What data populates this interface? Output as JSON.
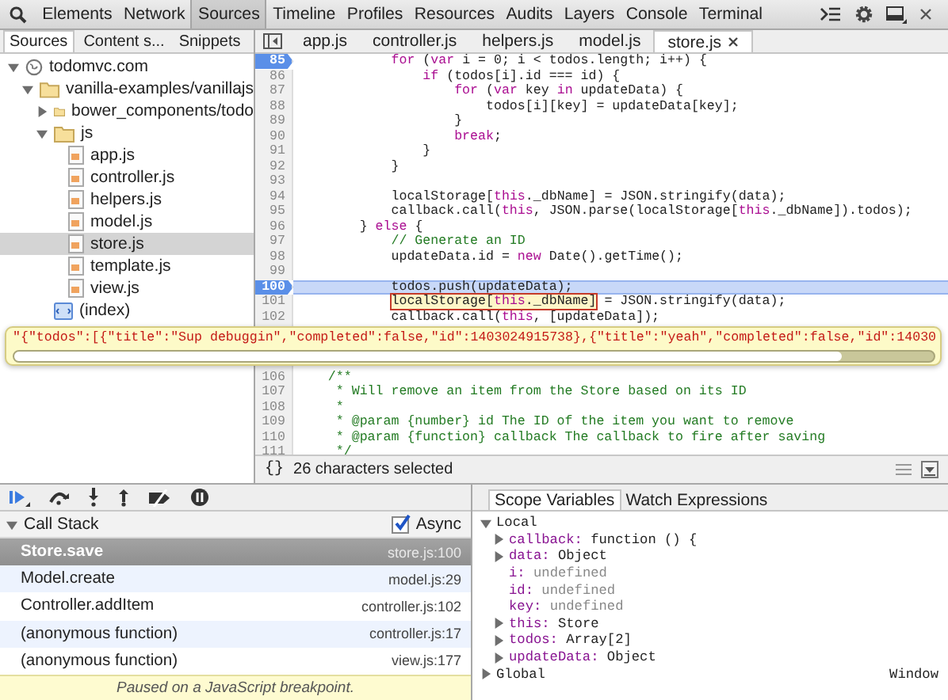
{
  "toolbar": {
    "tabs": [
      {
        "label": "Elements",
        "selected": false
      },
      {
        "label": "Network",
        "selected": false
      },
      {
        "label": "Sources",
        "selected": true
      },
      {
        "label": "Timeline",
        "selected": false
      },
      {
        "label": "Profiles",
        "selected": false
      },
      {
        "label": "Resources",
        "selected": false
      },
      {
        "label": "Audits",
        "selected": false
      },
      {
        "label": "Layers",
        "selected": false
      },
      {
        "label": "Console",
        "selected": false
      },
      {
        "label": "Terminal",
        "selected": false
      }
    ]
  },
  "navigator": {
    "tabs": [
      {
        "label": "Sources",
        "selected": true
      },
      {
        "label": "Content s...",
        "selected": false
      },
      {
        "label": "Snippets",
        "selected": false
      }
    ],
    "tree": [
      {
        "label": "todomvc.com",
        "kind": "domain",
        "expanded": true,
        "children": [
          {
            "label": "vanilla-examples/vanillajs",
            "kind": "folder",
            "expanded": true,
            "children": [
              {
                "label": "bower_components/todo",
                "kind": "folder",
                "expanded": false
              },
              {
                "label": "js",
                "kind": "folder",
                "expanded": true,
                "children": [
                  {
                    "label": "app.js",
                    "kind": "file",
                    "selected": false
                  },
                  {
                    "label": "controller.js",
                    "kind": "file",
                    "selected": false
                  },
                  {
                    "label": "helpers.js",
                    "kind": "file",
                    "selected": false
                  },
                  {
                    "label": "model.js",
                    "kind": "file",
                    "selected": false
                  },
                  {
                    "label": "store.js",
                    "kind": "file",
                    "selected": true
                  },
                  {
                    "label": "template.js",
                    "kind": "file",
                    "selected": false
                  },
                  {
                    "label": "view.js",
                    "kind": "file",
                    "selected": false
                  }
                ]
              },
              {
                "label": "(index)",
                "kind": "document",
                "selected": false
              }
            ]
          }
        ]
      }
    ]
  },
  "editor": {
    "tabs": [
      {
        "label": "app.js",
        "selected": false,
        "closable": false
      },
      {
        "label": "controller.js",
        "selected": false,
        "closable": false
      },
      {
        "label": "helpers.js",
        "selected": false,
        "closable": false
      },
      {
        "label": "model.js",
        "selected": false,
        "closable": false
      },
      {
        "label": "store.js",
        "selected": true,
        "closable": true
      }
    ],
    "lines": [
      {
        "number": "85",
        "breakpoint": true,
        "current": false,
        "tokens": [
          {
            "kind": "keyword",
            "text": "            for"
          },
          {
            "kind": "plain",
            "text": " ("
          },
          {
            "kind": "keyword",
            "text": "var"
          },
          {
            "kind": "plain",
            "text": " i = 0; i < todos.length; i++) {"
          }
        ]
      },
      {
        "number": "86",
        "breakpoint": false,
        "current": false,
        "tokens": [
          {
            "kind": "keyword",
            "text": "                if"
          },
          {
            "kind": "plain",
            "text": " (todos[i].id === id) {"
          }
        ]
      },
      {
        "number": "87",
        "breakpoint": false,
        "current": false,
        "tokens": [
          {
            "kind": "keyword",
            "text": "                    for"
          },
          {
            "kind": "plain",
            "text": " ("
          },
          {
            "kind": "keyword",
            "text": "var"
          },
          {
            "kind": "plain",
            "text": " key "
          },
          {
            "kind": "keyword",
            "text": "in"
          },
          {
            "kind": "plain",
            "text": " updateData) {"
          }
        ]
      },
      {
        "number": "88",
        "breakpoint": false,
        "current": false,
        "tokens": [
          {
            "kind": "plain",
            "text": "                        todos[i][key] = updateData[key];"
          }
        ]
      },
      {
        "number": "89",
        "breakpoint": false,
        "current": false,
        "tokens": [
          {
            "kind": "plain",
            "text": "                    }"
          }
        ]
      },
      {
        "number": "90",
        "breakpoint": false,
        "current": false,
        "tokens": [
          {
            "kind": "keyword",
            "text": "                    break"
          },
          {
            "kind": "plain",
            "text": ";"
          }
        ]
      },
      {
        "number": "91",
        "breakpoint": false,
        "current": false,
        "tokens": [
          {
            "kind": "plain",
            "text": "                }"
          }
        ]
      },
      {
        "number": "92",
        "breakpoint": false,
        "current": false,
        "tokens": [
          {
            "kind": "plain",
            "text": "            }"
          }
        ]
      },
      {
        "number": "93",
        "breakpoint": false,
        "current": false
      },
      {
        "number": "94",
        "breakpoint": false,
        "current": false,
        "tokens": [
          {
            "kind": "plain",
            "text": "            localStorage["
          },
          {
            "kind": "keyword",
            "text": "this"
          },
          {
            "kind": "plain",
            "text": "._dbName] = JSON.stringify(data);"
          }
        ]
      },
      {
        "number": "95",
        "breakpoint": false,
        "current": false,
        "tokens": [
          {
            "kind": "plain",
            "text": "            callback.call("
          },
          {
            "kind": "keyword",
            "text": "this"
          },
          {
            "kind": "plain",
            "text": ", JSON.parse(localStorage["
          },
          {
            "kind": "keyword",
            "text": "this"
          },
          {
            "kind": "plain",
            "text": "._dbName]).todos);"
          }
        ]
      },
      {
        "number": "96",
        "breakpoint": false,
        "current": false,
        "tokens": [
          {
            "kind": "plain",
            "text": "        } "
          },
          {
            "kind": "keyword",
            "text": "else"
          },
          {
            "kind": "plain",
            "text": " {"
          }
        ]
      },
      {
        "number": "97",
        "breakpoint": false,
        "current": false,
        "tokens": [
          {
            "kind": "comment",
            "text": "            // Generate an ID"
          }
        ]
      },
      {
        "number": "98",
        "breakpoint": false,
        "current": false,
        "tokens": [
          {
            "kind": "plain",
            "text": "            updateData.id = "
          },
          {
            "kind": "keyword",
            "text": "new"
          },
          {
            "kind": "plain",
            "text": " Date().getTime();"
          }
        ]
      },
      {
        "number": "99",
        "breakpoint": false,
        "current": false
      },
      {
        "number": "100",
        "breakpoint": true,
        "current": true,
        "tokens": [
          {
            "kind": "plain",
            "text": "            todos.push(updateData);"
          }
        ]
      },
      {
        "number": "101",
        "breakpoint": false,
        "current": false,
        "tokens": [
          {
            "kind": "highlight",
            "parts": [
              {
                "kind": "plain",
                "text": "            localStorage["
              },
              {
                "kind": "keyword",
                "text": "this"
              },
              {
                "kind": "plain",
                "text": "._dbName]"
              }
            ]
          },
          {
            "kind": "plain",
            "text": " = JSON.stringify(data);"
          }
        ]
      },
      {
        "number": "102",
        "breakpoint": false,
        "current": false,
        "tokens": [
          {
            "kind": "plain",
            "text": "            callback.call("
          },
          {
            "kind": "keyword",
            "text": "this"
          },
          {
            "kind": "plain",
            "text": ", [updateData]);"
          }
        ]
      },
      {
        "number": "106",
        "breakpoint": false,
        "current": false,
        "tokens": [
          {
            "kind": "comment",
            "text": "    /**"
          }
        ]
      },
      {
        "number": "107",
        "breakpoint": false,
        "current": false,
        "tokens": [
          {
            "kind": "comment",
            "text": "     * Will remove an item from the Store based on its ID"
          }
        ]
      },
      {
        "number": "108",
        "breakpoint": false,
        "current": false,
        "tokens": [
          {
            "kind": "comment",
            "text": "     *"
          }
        ]
      },
      {
        "number": "109",
        "breakpoint": false,
        "current": false,
        "tokens": [
          {
            "kind": "comment",
            "text": "     * @param {number} id The ID of the item you want to remove"
          }
        ]
      },
      {
        "number": "110",
        "breakpoint": false,
        "current": false,
        "tokens": [
          {
            "kind": "comment",
            "text": "     * @param {function} callback The callback to fire after saving"
          }
        ]
      },
      {
        "number": "111",
        "breakpoint": false,
        "current": false,
        "tokens": [
          {
            "kind": "comment",
            "text": "     */"
          }
        ]
      }
    ],
    "popover": {
      "value": "\"{\"todos\":[{\"title\":\"Sup debuggin\",\"completed\":false,\"id\":1403024915738},{\"title\":\"yeah\",\"completed\":false,\"id\":14030"
    },
    "format_button": "{}",
    "status": "26 characters selected"
  },
  "call_stack": {
    "title": "Call Stack",
    "expanded": true,
    "async_label": "Async",
    "async": true,
    "frames": [
      {
        "name": "Store.save",
        "location": "store.js:100",
        "selected": true
      },
      {
        "name": "Model.create",
        "location": "model.js:29",
        "selected": false
      },
      {
        "name": "Controller.addItem",
        "location": "controller.js:102",
        "selected": false
      },
      {
        "name": "(anonymous function)",
        "location": "controller.js:17",
        "selected": false
      },
      {
        "name": "(anonymous function)",
        "location": "view.js:177",
        "selected": false
      }
    ]
  },
  "paused_message": "Paused on a JavaScript breakpoint.",
  "scope": {
    "tabs": [
      {
        "label": "Scope Variables",
        "selected": true
      },
      {
        "label": "Watch Expressions",
        "selected": false
      }
    ],
    "sections": [
      {
        "title": "Local",
        "expanded": true,
        "items": [
          {
            "name": "callback:",
            "value": "function () {",
            "expandable": true,
            "kind": "value"
          },
          {
            "name": "data:",
            "value": "Object",
            "expandable": true,
            "kind": "value"
          },
          {
            "name": "i:",
            "value": "undefined",
            "expandable": false,
            "kind": "undefined"
          },
          {
            "name": "id:",
            "value": "undefined",
            "expandable": false,
            "kind": "undefined"
          },
          {
            "name": "key:",
            "value": "undefined",
            "expandable": false,
            "kind": "undefined"
          },
          {
            "name": "this:",
            "value": "Store",
            "expandable": true,
            "kind": "value"
          },
          {
            "name": "todos:",
            "value": "Array[2]",
            "expandable": true,
            "kind": "value"
          },
          {
            "name": "updateData:",
            "value": "Object",
            "expandable": true,
            "kind": "value"
          }
        ]
      },
      {
        "title": "Global",
        "expanded": false,
        "value": "Window"
      }
    ]
  }
}
